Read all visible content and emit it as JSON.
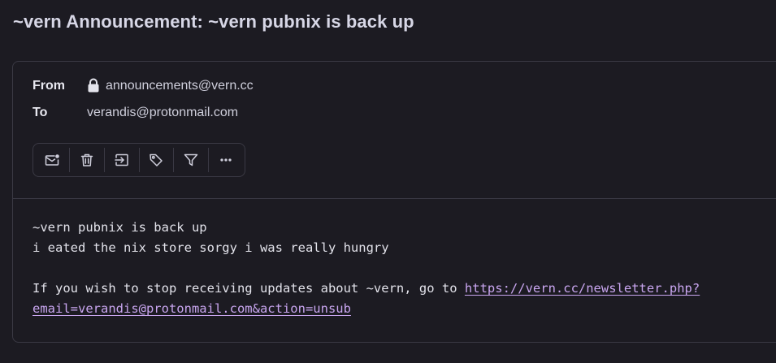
{
  "message": {
    "subject": "~vern Announcement: ~vern pubnix is back up",
    "from_label": "From",
    "from_value": "announcements@vern.cc",
    "to_label": "To",
    "to_value": "verandis@protonmail.com"
  },
  "toolbar": {
    "buttons": [
      {
        "icon": "mark-unread-icon"
      },
      {
        "icon": "trash-icon"
      },
      {
        "icon": "move-to-folder-icon"
      },
      {
        "icon": "label-tag-icon"
      },
      {
        "icon": "filter-icon"
      },
      {
        "icon": "more-options-icon"
      }
    ]
  },
  "body": {
    "line1": "~vern pubnix is back up",
    "line2": "i eated the nix store sorgy i was really hungry",
    "line3_prefix": "If you wish to stop receiving updates about ~vern, go to ",
    "link_part1": "https://vern.cc/newsletter.php?",
    "link_part2": "email=verandis@protonmail.com&action=unsub"
  },
  "colors": {
    "background": "#1c1b22",
    "border": "#3a3944",
    "link": "#c9a6f0"
  }
}
